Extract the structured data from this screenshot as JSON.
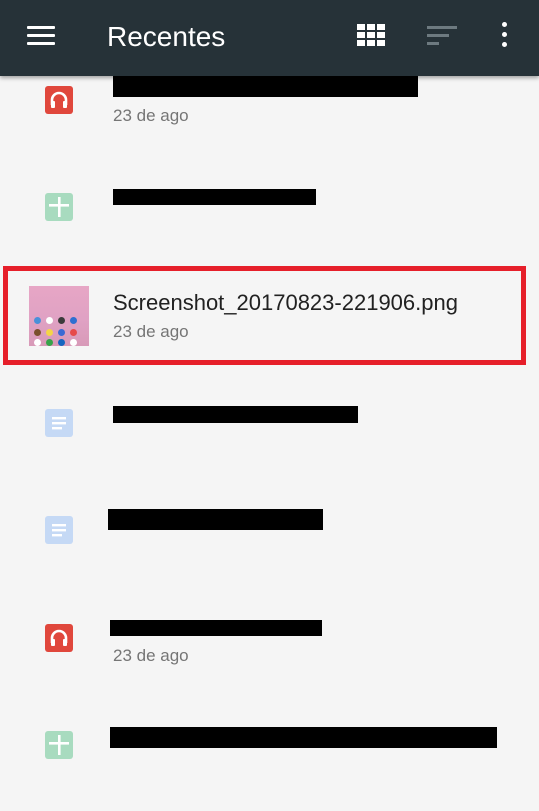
{
  "appbar": {
    "title": "Recentes",
    "icons": [
      "menu-icon",
      "grid-view-icon",
      "sort-icon",
      "more-vert-icon"
    ]
  },
  "files": [
    {
      "type": "audio",
      "date": "23 de ago"
    },
    {
      "type": "spreadsheet"
    },
    {
      "type": "image",
      "name": "Screenshot_20170823-221906.png",
      "date": "23 de ago",
      "highlighted": true
    },
    {
      "type": "document"
    },
    {
      "type": "document"
    },
    {
      "type": "audio",
      "date": "23 de ago"
    },
    {
      "type": "spreadsheet"
    }
  ],
  "colors": {
    "appbar": "#263238",
    "highlight": "#e61f2a",
    "audio": "#e0473c",
    "spreadsheet": "#a8dbbf",
    "document": "#c5d9f5"
  }
}
